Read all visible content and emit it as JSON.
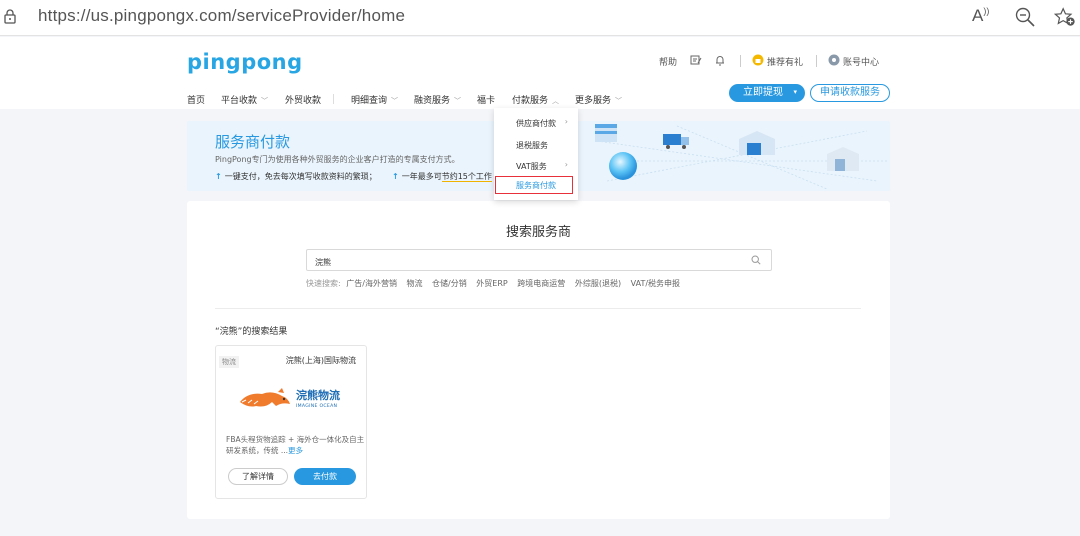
{
  "browser": {
    "url": "https://us.pingpongx.com/serviceProvider/home",
    "read_aloud": "A"
  },
  "header": {
    "logo": "pingpong",
    "help": "帮助",
    "recommend": "推荐有礼",
    "account": "账号中心",
    "nav": [
      {
        "label": "首页"
      },
      {
        "label": "平台收款"
      },
      {
        "label": "外贸收款"
      },
      {
        "label": "明细查询"
      },
      {
        "label": "融资服务"
      },
      {
        "label": "福卡"
      },
      {
        "label": "付款服务"
      },
      {
        "label": "更多服务"
      }
    ],
    "withdraw_btn": "立即提现",
    "apply_btn": "申请收款服务"
  },
  "dropdown": {
    "items": [
      {
        "label": "供应商付款"
      },
      {
        "label": "退税服务"
      },
      {
        "label": "VAT服务"
      }
    ],
    "active": "服务商付款"
  },
  "banner": {
    "title": "服务商付款",
    "subtitle": "PingPong专门为使用各种外贸服务的企业客户打造的专属支付方式。",
    "feature1": "一键支付，免去每次填写收款资料的繁琐；",
    "feature2_a": "一年最多可",
    "feature2_b": "节约15个工作"
  },
  "search": {
    "title": "搜索服务商",
    "value": "浣熊",
    "quick_label": "快速搜索:",
    "quick_tags": [
      "广告/海外营销",
      "物流",
      "仓储/分销",
      "外贸ERP",
      "跨境电商运营",
      "外综服(退税)",
      "VAT/税务申报"
    ]
  },
  "results": {
    "title": "“浣熊”的搜索结果",
    "cards": [
      {
        "tag": "物流",
        "name": "浣熊(上海)国际物流",
        "logo_cn": "浣熊物流",
        "logo_en": "IMAGINE OCEAN",
        "desc": "FBA头程货物追踪 + 海外仓一体化及自主研发系统，传统 ...",
        "more": "更多",
        "detail_btn": "了解详情",
        "pay_btn": "去付款"
      }
    ]
  },
  "colors": {
    "accent": "#2899e0",
    "highlight_border": "#e8303a"
  }
}
